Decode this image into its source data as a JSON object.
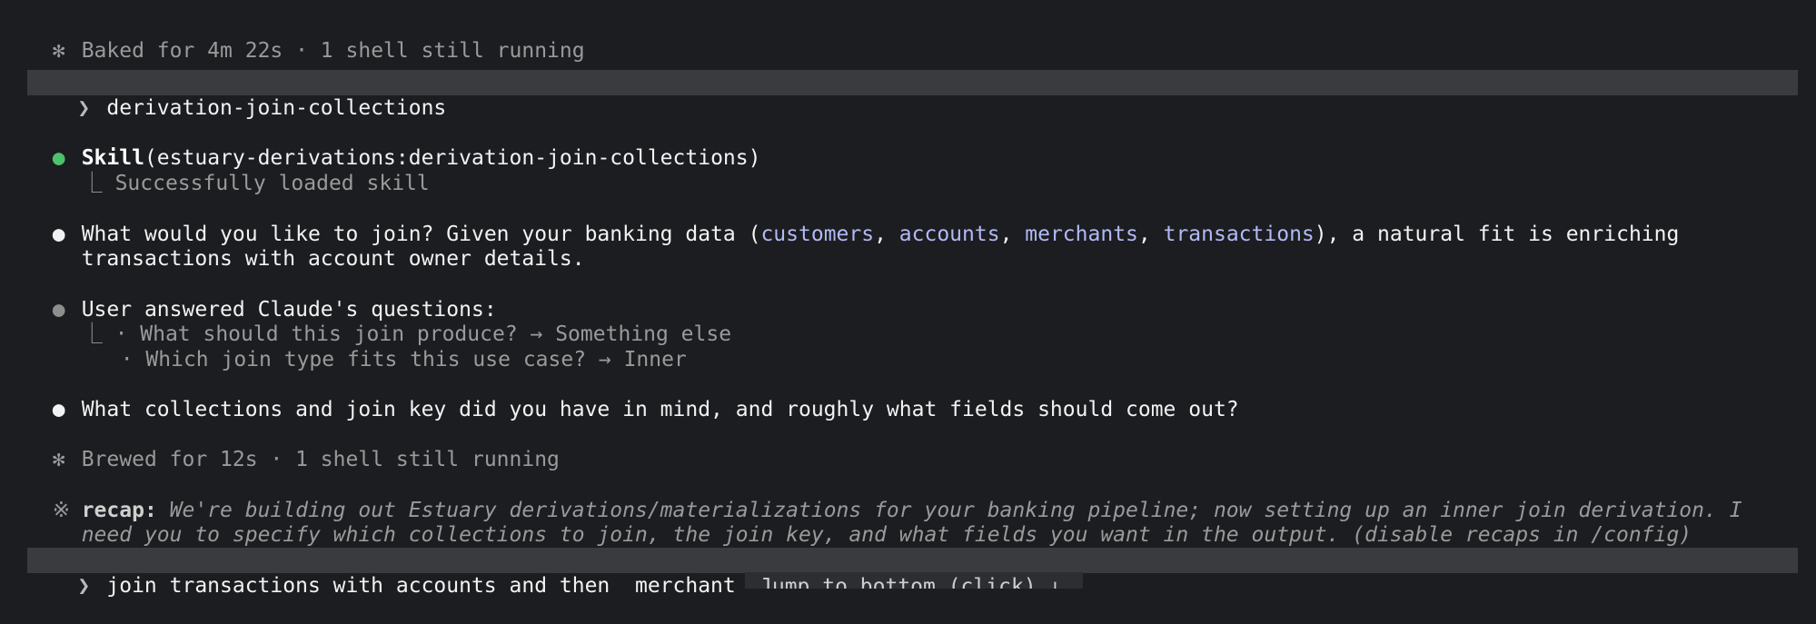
{
  "status_top": {
    "glyph": "✻",
    "text": "Baked for 4m 22s · 1 shell still running"
  },
  "prompt1": {
    "glyph": "❯",
    "text": "derivation-join-collections"
  },
  "skill": {
    "glyph": "●",
    "name": "Skill",
    "args": "(estuary-derivations:derivation-join-collections)",
    "result_glyph": "⎿",
    "result": "Successfully loaded skill"
  },
  "message1": {
    "glyph": "●",
    "before": "What would you like to join? Given your banking data (",
    "items": [
      "customers",
      "accounts",
      "merchants",
      "transactions"
    ],
    "sep": ", ",
    "after": "), a natural fit is enriching",
    "line2": "transactions with account owner details."
  },
  "answers": {
    "glyph": "●",
    "title": "User answered Claude's questions:",
    "result_glyph": "⎿",
    "items": [
      "· What should this join produce? → Something else",
      "· Which join type fits this use case? → Inner"
    ]
  },
  "message2": {
    "glyph": "●",
    "text": "What collections and join key did you have in mind, and roughly what fields should come out?"
  },
  "status_mid": {
    "glyph": "✻",
    "text": "Brewed for 12s · 1 shell still running"
  },
  "recap": {
    "glyph": "※",
    "label": "recap:",
    "line1": " We're building out Estuary derivations/materializations for your banking pipeline; now setting up an inner join derivation. I",
    "line2": "need you to specify which collections to join, the join key, and what fields you want in the output. (disable recaps in /config)"
  },
  "prompt2": {
    "glyph": "❯",
    "text": "join transactions with accounts and then  merchant"
  },
  "jump": {
    "text": "Jump to bottom (click) ↓"
  },
  "colors": {
    "background": "#1c1d20",
    "prompt_bar": "#3a3b3f",
    "accent": "#b2b9f5",
    "success_dot": "#4cc26a",
    "dim_text": "#9a9a9a"
  }
}
